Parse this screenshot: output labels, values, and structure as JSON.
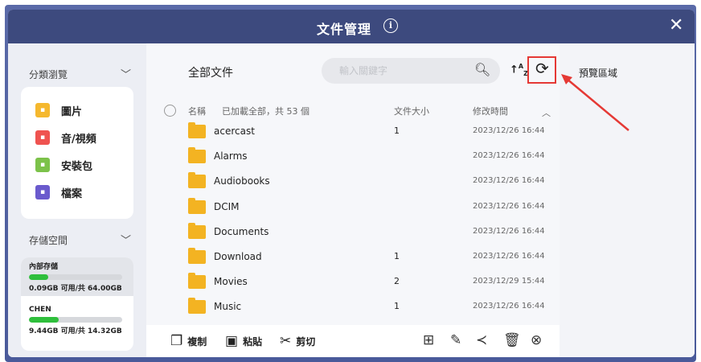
{
  "window": {
    "title": "文件管理",
    "info_icon": "info-icon",
    "close_icon": "close-icon",
    "close_glyph": "✕"
  },
  "sidebar": {
    "categories_header": "分類瀏覽",
    "categories": [
      {
        "label": "圖片",
        "icon": "image-icon",
        "color": "#f5b82e"
      },
      {
        "label": "音/視頻",
        "icon": "video-icon",
        "color": "#ef5350"
      },
      {
        "label": "安裝包",
        "icon": "package-icon",
        "color": "#7cc24a"
      },
      {
        "label": "檔案",
        "icon": "document-icon",
        "color": "#6a5acd"
      }
    ],
    "storage_header": "存儲空間",
    "storage": [
      {
        "name": "內部存儲",
        "usage": "0.09GB 可用/共 64.00GB",
        "fill_percent": 21
      },
      {
        "name": "CHEN",
        "usage": "9.44GB 可用/共 14.32GB",
        "fill_percent": 32
      }
    ]
  },
  "main": {
    "breadcrumb": "全部文件",
    "search_placeholder": "輸入關鍵字",
    "header": {
      "name": "名稱",
      "loaded": "已加載全部，共 53 個",
      "size": "文件大小",
      "modified": "修改時間",
      "collapse_glyph": "︿"
    },
    "files": [
      {
        "name": "acercast",
        "size": "1",
        "date": "2023/12/26 16:44"
      },
      {
        "name": "Alarms",
        "size": "",
        "date": "2023/12/26 16:44"
      },
      {
        "name": "Audiobooks",
        "size": "",
        "date": "2023/12/26 16:44"
      },
      {
        "name": "DCIM",
        "size": "",
        "date": "2023/12/26 16:44"
      },
      {
        "name": "Documents",
        "size": "",
        "date": "2023/12/26 16:44"
      },
      {
        "name": "Download",
        "size": "1",
        "date": "2023/12/26 16:44"
      },
      {
        "name": "Movies",
        "size": "2",
        "date": "2023/12/29 15:44"
      },
      {
        "name": "Music",
        "size": "1",
        "date": "2023/12/26 16:44"
      }
    ],
    "toolbar": {
      "copy": "複制",
      "paste": "粘貼",
      "cut": "剪切"
    }
  },
  "preview": {
    "title": "預覽區域"
  },
  "colors": {
    "titlebar": "#3d4a7e",
    "accent_red": "#e53935",
    "folder": "#f3b322",
    "storage_bar": "#2fbf3c"
  }
}
